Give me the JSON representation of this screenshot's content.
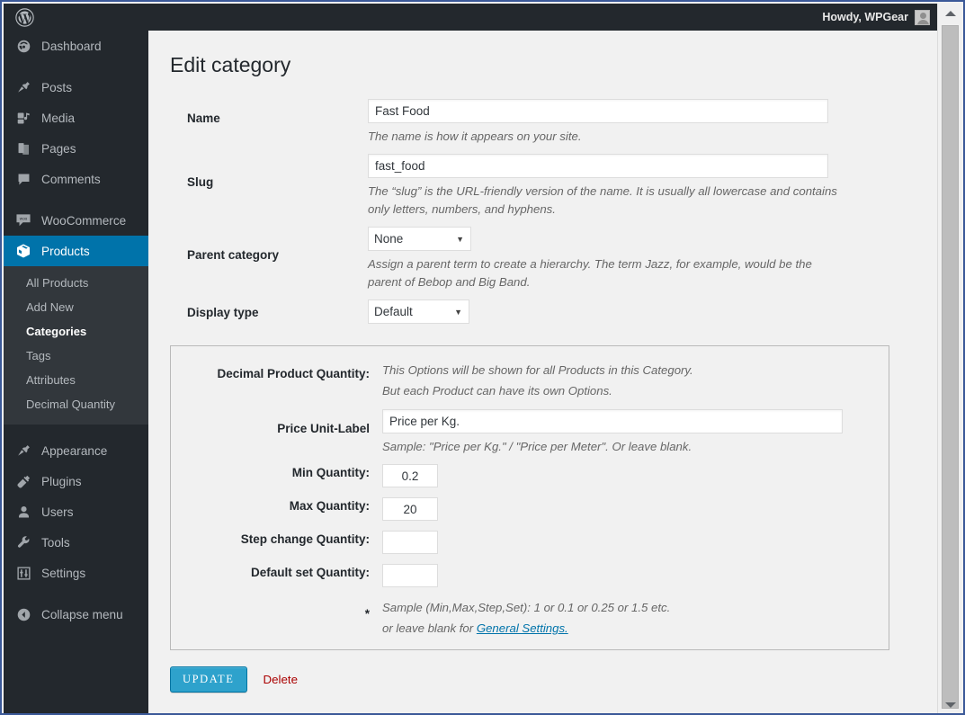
{
  "adminbar": {
    "logo_icon": "wordpress-logo-icon",
    "greeting": "Howdy, WPGear",
    "avatar_icon": "user-avatar-icon"
  },
  "sidebar": {
    "items": [
      {
        "label": "Dashboard",
        "icon": "dashboard-gauge-icon"
      },
      {
        "label": "Posts",
        "icon": "pin-icon"
      },
      {
        "label": "Media",
        "icon": "media-icon"
      },
      {
        "label": "Pages",
        "icon": "pages-icon"
      },
      {
        "label": "Comments",
        "icon": "comment-bubble-icon"
      },
      {
        "label": "WooCommerce",
        "icon": "woocommerce-icon"
      },
      {
        "label": "Products",
        "icon": "product-box-icon",
        "active": true
      },
      {
        "label": "Appearance",
        "icon": "paintbrush-icon"
      },
      {
        "label": "Plugins",
        "icon": "plug-icon"
      },
      {
        "label": "Users",
        "icon": "user-icon"
      },
      {
        "label": "Tools",
        "icon": "wrench-icon"
      },
      {
        "label": "Settings",
        "icon": "sliders-icon"
      }
    ],
    "submenu": [
      {
        "label": "All Products"
      },
      {
        "label": "Add New"
      },
      {
        "label": "Categories",
        "current": true
      },
      {
        "label": "Tags"
      },
      {
        "label": "Attributes"
      },
      {
        "label": "Decimal Quantity"
      }
    ],
    "collapse": {
      "label": "Collapse menu",
      "icon": "collapse-arrow-icon"
    },
    "active_color": "#0073aa"
  },
  "page": {
    "title": "Edit category"
  },
  "form": {
    "name": {
      "label": "Name",
      "value": "Fast Food",
      "placeholder": "",
      "description": "The name is how it appears on your site."
    },
    "slug": {
      "label": "Slug",
      "value": "fast_food",
      "placeholder": "",
      "description": "The “slug” is the URL-friendly version of the name. It is usually all lowercase and contains only letters, numbers, and hyphens."
    },
    "parent": {
      "label": "Parent category",
      "value": "None",
      "options": [
        "None"
      ],
      "description": "Assign a parent term to create a hierarchy. The term Jazz, for example, would be the parent of Bebop and Big Band."
    },
    "display_type": {
      "label": "Display type",
      "value": "Default",
      "options": [
        "Default"
      ]
    }
  },
  "decimal_box": {
    "label": "Decimal Product Quantity:",
    "note_line1": "This Options will be shown for all Products in this Category.",
    "note_line2": "But each Product can have its own Options.",
    "price_unit": {
      "label": "Price Unit-Label",
      "value": "Price per Kg.",
      "placeholder": "",
      "description": "Sample: \"Price per Kg.\" / \"Price per Meter\". Or leave blank."
    },
    "min": {
      "label": "Min Quantity:",
      "value": "0.2",
      "placeholder": ""
    },
    "max": {
      "label": "Max Quantity:",
      "value": "20",
      "placeholder": ""
    },
    "step": {
      "label": "Step change Quantity:",
      "value": "",
      "placeholder": ""
    },
    "default": {
      "label": "Default set Quantity:",
      "value": "",
      "placeholder": ""
    },
    "asterisk": "*",
    "sample_line1": "Sample (Min,Max,Step,Set): 1 or 0.1 or 0.25 or 1.5 etc.",
    "sample_prefix": "or leave blank for ",
    "sample_link": "General Settings.",
    "link_color": "#0073aa"
  },
  "submit": {
    "update_label": "Update",
    "delete_label": "Delete",
    "primary_color": "#2ea2cc",
    "delete_color": "#a00"
  },
  "scrollbar": {
    "up_icon": "scroll-up-arrow-icon",
    "down_icon": "scroll-down-arrow-icon"
  }
}
